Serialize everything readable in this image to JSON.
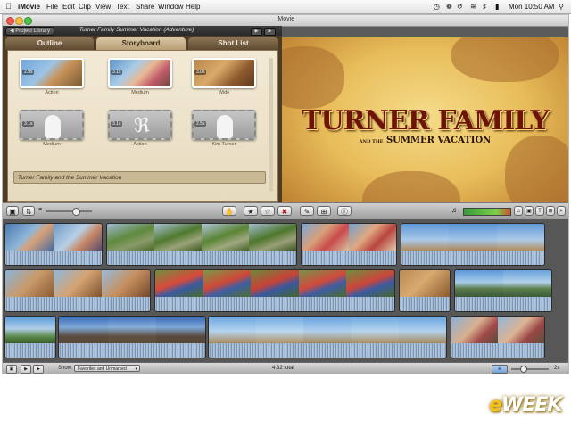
{
  "menubar": {
    "app": "iMovie",
    "menus": [
      "File",
      "Edit",
      "Clip",
      "View",
      "Text",
      "Share",
      "Window",
      "Help"
    ],
    "clock": "Mon 10:50 AM"
  },
  "window": {
    "title": "iMovie"
  },
  "project": {
    "library_button": "Project Library",
    "title": "Turner Family Summer Vacation (Adventure)",
    "tabs": [
      "Outline",
      "Storyboard",
      "Shot List"
    ],
    "active_tab": "Storyboard",
    "cards": [
      {
        "label": "Action",
        "duration": "2.9s"
      },
      {
        "label": "Medium",
        "duration": "3.1s"
      },
      {
        "label": "Wide",
        "duration": "3.0s"
      },
      {
        "label": "Medium",
        "duration": "3.1s"
      },
      {
        "label": "Action",
        "duration": "3.1s"
      },
      {
        "label": "Kim Turner",
        "duration": "2.5s"
      }
    ],
    "caption": "Turner Family and the Summer Vacation"
  },
  "viewer": {
    "title_main": "TURNER FAMILY",
    "title_sub_prefix": "AND THE",
    "title_sub": "SUMMER VACATION"
  },
  "statusbar": {
    "show_label": "Show:",
    "show_value": "Favorites and Unmarked",
    "total": "4.32 total",
    "zoom": "2s"
  },
  "colors": {
    "accent": "#6e1308",
    "map": "#e8bd5a",
    "leather": "#4e3b24"
  },
  "logo": {
    "text": "eWEEK"
  }
}
